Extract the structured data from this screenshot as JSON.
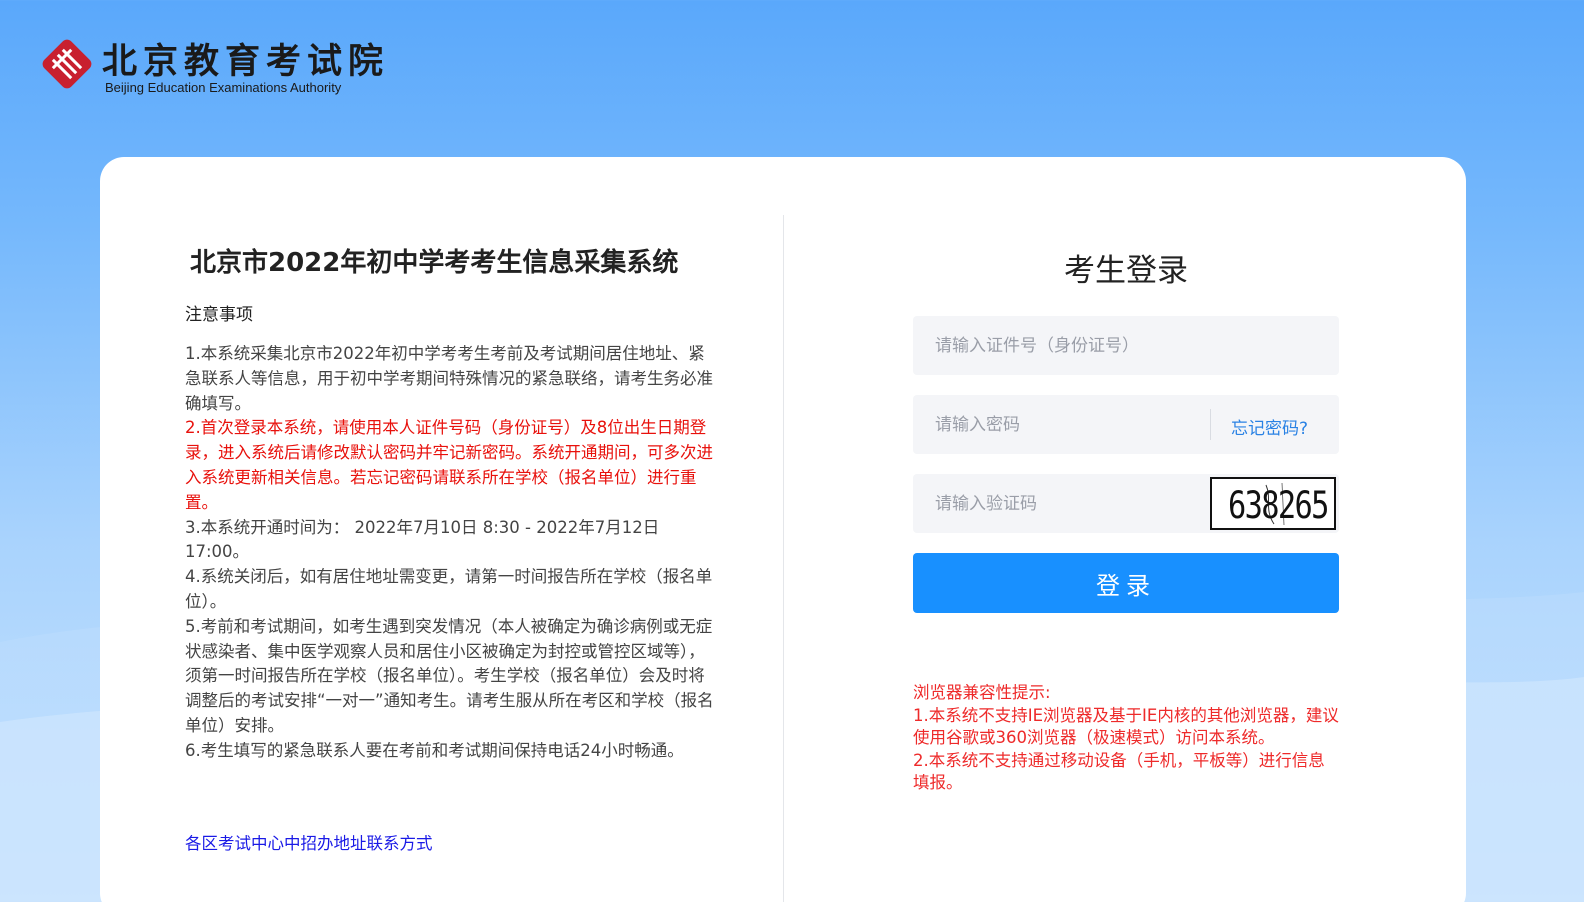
{
  "brand": {
    "name_cn": "北京教育考试院",
    "name_en": "Beijing Education Examinations Authority",
    "logo_icon": "beea-logo-icon",
    "accent_color": "#c8202f"
  },
  "left_panel": {
    "system_title": "北京市2022年初中学考考生信息采集系统",
    "notice_heading": "注意事项",
    "notices": [
      "1.本系统采集北京市2022年初中学考考生考前及考试期间居住地址、紧急联系人等信息，用于初中学考期间特殊情况的紧急联络，请考生务必准确填写。",
      "2.首次登录本系统，请使用本人证件号码（身份证号）及8位出生日期登录，进入系统后请修改默认密码并牢记新密码。系统开通期间，可多次进入系统更新相关信息。若忘记密码请联系所在学校（报名单位）进行重置。",
      "3.本系统开通时间为： 2022年7月10日  8:30 - 2022年7月12日 17:00。",
      "4.系统关闭后，如有居住地址需变更，请第一时间报告所在学校（报名单位）。",
      "5.考前和考试期间，如考生遇到突发情况（本人被确定为确诊病例或无症状感染者、集中医学观察人员和居住小区被确定为封控或管控区域等），须第一时间报告所在学校（报名单位）。考生学校（报名单位）会及时将调整后的考试安排“一对一”通知考生。请考生服从所在考区和学校（报名单位）安排。",
      "6.考生填写的紧急联系人要在考前和考试期间保持电话24小时畅通。"
    ],
    "important_notice_color": "#e8110c",
    "district_link": "各区考试中心中招办地址联系方式"
  },
  "login": {
    "title": "考生登录",
    "id_placeholder": "请输入证件号（身份证号）",
    "id_value": "",
    "password_placeholder": "请输入密码",
    "password_value": "",
    "forgot_label": "忘记密码?",
    "captcha_placeholder": "请输入验证码",
    "captcha_value": "",
    "captcha_image_text": "638265",
    "submit_label": "登录",
    "button_color": "#1890ff"
  },
  "compat": {
    "heading": "浏览器兼容性提示:",
    "items": [
      "1.本系统不支持IE浏览器及基于IE内核的其他浏览器，建议使用谷歌或360浏览器（极速模式）访问本系统。",
      "2.本系统不支持通过移动设备（手机，平板等）进行信息填报。"
    ]
  }
}
